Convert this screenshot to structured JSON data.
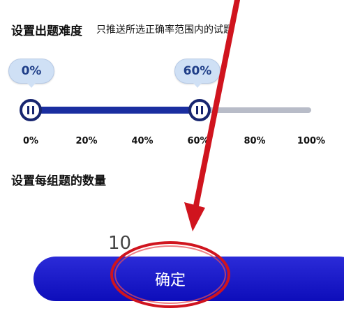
{
  "difficulty": {
    "title": "设置出题难度",
    "subtitle": "只推送所选正确率范围内的试题",
    "slider": {
      "min_label": "0%",
      "max_label": "60%",
      "min_value": 0,
      "max_value": 60,
      "range": [
        0,
        100
      ]
    },
    "ticks": [
      "0%",
      "20%",
      "40%",
      "60%",
      "80%",
      "100%"
    ]
  },
  "group_count": {
    "title": "设置每组题的数量",
    "value": "10"
  },
  "confirm_button": {
    "label": "确定"
  },
  "colors": {
    "accent": "#1a2ea0",
    "button": "#1414c8",
    "annotation": "#d0141e"
  }
}
